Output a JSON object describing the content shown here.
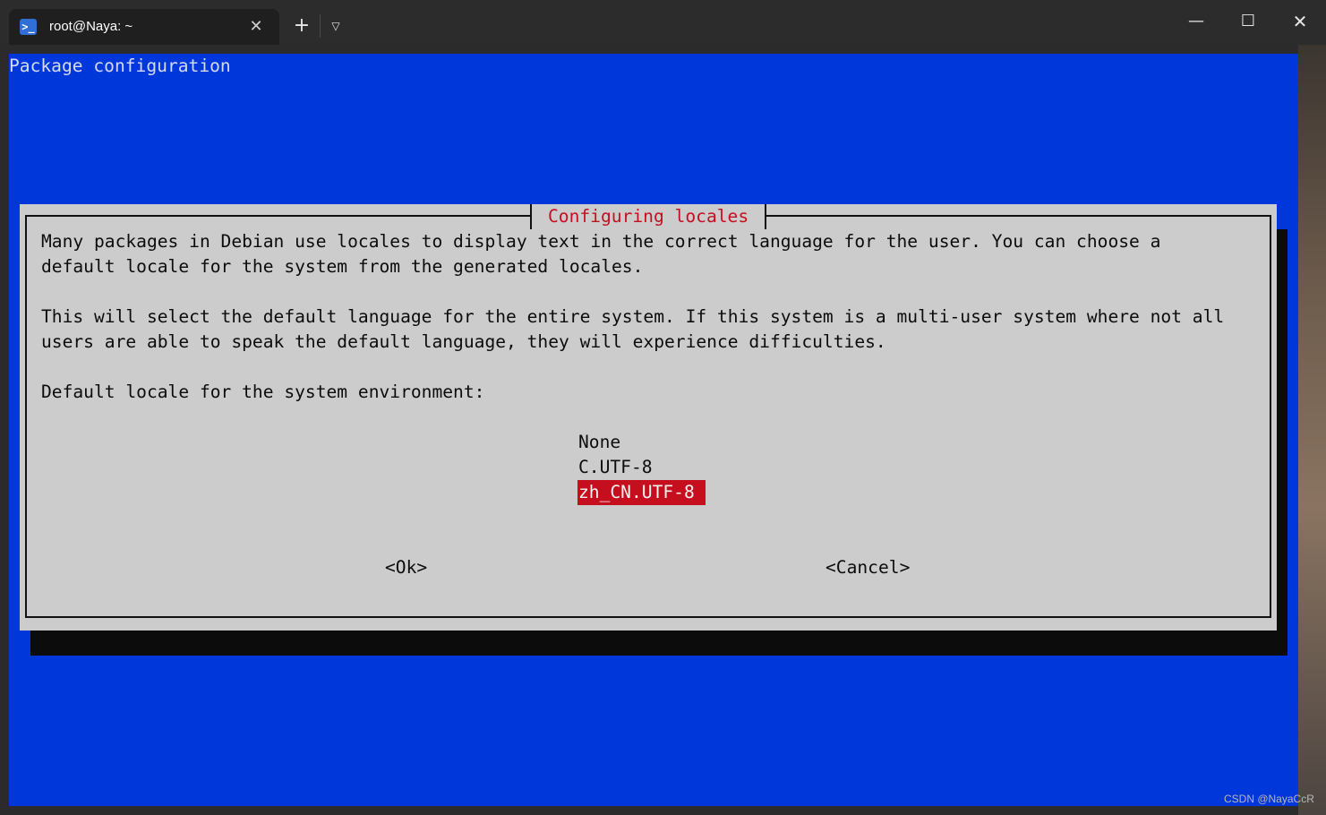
{
  "tab": {
    "title": "root@Naya: ~",
    "icon": "powershell-icon",
    "close_glyph": "✕"
  },
  "toolbar": {
    "new_tab_glyph": "+",
    "dropdown_glyph": "⌄"
  },
  "window_controls": {
    "minimize": "—",
    "maximize": "☐",
    "close": "✕"
  },
  "terminal": {
    "header": "Package configuration",
    "background_color": "#0037da"
  },
  "dialog": {
    "title": "Configuring locales",
    "paragraphs": [
      "Many packages in Debian use locales to display text in the correct language for the user. You can choose a",
      "default locale for the system from the generated locales.",
      "This will select the default language for the entire system. If this system is a multi-user system where not all",
      "users are able to speak the default language, they will experience difficulties."
    ],
    "prompt": "Default locale for the system environment:",
    "options": [
      "None",
      "C.UTF-8",
      "zh_CN.UTF-8"
    ],
    "selected": "zh_CN.UTF-8",
    "ok_label": "<Ok>",
    "cancel_label": "<Cancel>",
    "accent_color": "#c50f1f"
  },
  "watermark": "CSDN @NayaCcR"
}
